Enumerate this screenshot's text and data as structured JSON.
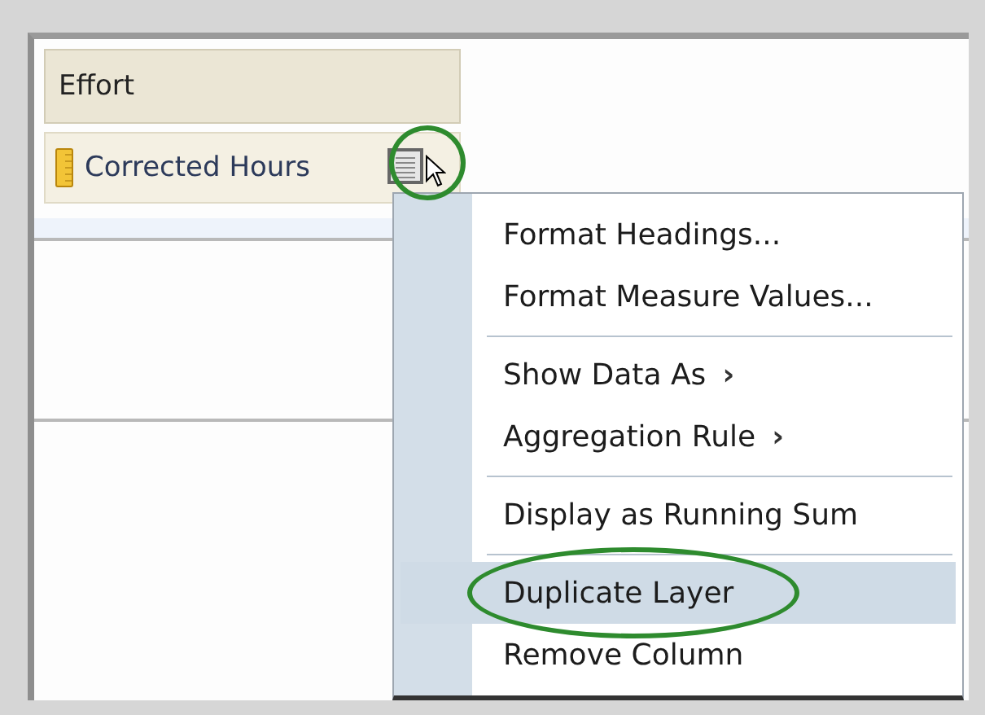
{
  "column_header": {
    "label": "Effort"
  },
  "measure": {
    "label": "Corrected Hours"
  },
  "context_menu": {
    "items": [
      {
        "label": "Format Headings...",
        "separator_before": false,
        "selected": false
      },
      {
        "label": "Format Measure Values...",
        "separator_before": false,
        "selected": false
      },
      {
        "label": "Show Data As",
        "separator_before": true,
        "submenu": "›",
        "selected": false
      },
      {
        "label": "Aggregation Rule",
        "separator_before": false,
        "submenu": "›",
        "selected": false
      },
      {
        "label": "Display as Running Sum",
        "separator_before": true,
        "selected": false
      },
      {
        "label": "Duplicate Layer",
        "separator_before": true,
        "selected": true
      },
      {
        "label": "Remove Column",
        "separator_before": false,
        "selected": false
      }
    ]
  }
}
